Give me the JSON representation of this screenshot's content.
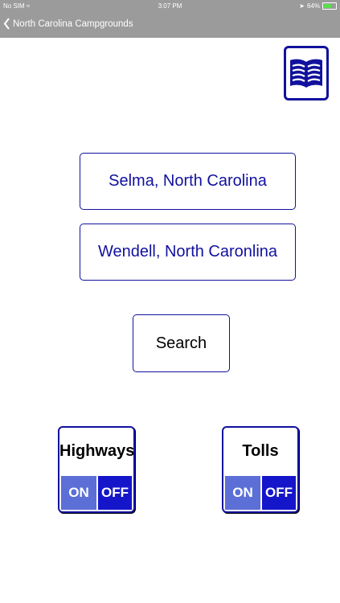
{
  "status_bar": {
    "carrier": "No SIM",
    "time": "3:07 PM",
    "battery": "64%",
    "battery_level": 0.64
  },
  "nav": {
    "title": "North Carolina Campgrounds"
  },
  "locations": {
    "start": "Selma, North Carolina",
    "end": "Wendell, North Caronlina"
  },
  "search_label": "Search",
  "toggles": {
    "highways": {
      "label": "Highways",
      "on": "ON",
      "off": "OFF"
    },
    "tolls": {
      "label": "Tolls",
      "on": "ON",
      "off": "OFF"
    }
  },
  "colors": {
    "accent": "#11119e",
    "bar": "#9b9b9b",
    "toggle_on": "#5b6fd6",
    "toggle_off": "#1516c9"
  }
}
